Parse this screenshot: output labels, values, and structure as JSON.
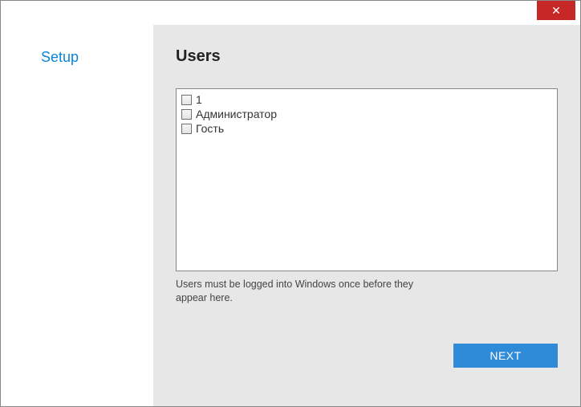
{
  "titlebar": {
    "close_glyph": "✕"
  },
  "sidebar": {
    "title": "Setup"
  },
  "main": {
    "heading": "Users",
    "users": [
      {
        "label": "1",
        "checked": false
      },
      {
        "label": "Администратор",
        "checked": false
      },
      {
        "label": "Гость",
        "checked": false
      }
    ],
    "hint": "Users must be logged into Windows once before they appear here.",
    "next_label": "NEXT"
  }
}
